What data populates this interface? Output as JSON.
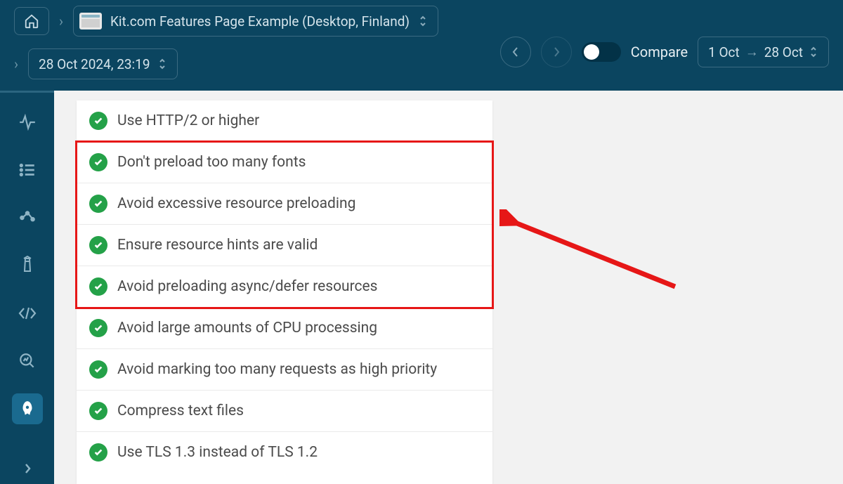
{
  "header": {
    "breadcrumb_title": "Kit.com Features Page Example (Desktop, Finland)",
    "datetime": "28 Oct 2024, 23:19",
    "compare_label": "Compare",
    "range_from": "1 Oct",
    "range_to": "28 Oct"
  },
  "sidebar": {
    "items": [
      {
        "name": "pulse-icon"
      },
      {
        "name": "list-icon"
      },
      {
        "name": "network-icon"
      },
      {
        "name": "lighthouse-icon"
      },
      {
        "name": "code-icon"
      },
      {
        "name": "search-chart-icon"
      },
      {
        "name": "rocket-icon",
        "active": true
      }
    ]
  },
  "audits": [
    {
      "label": "Use HTTP/2 or higher"
    },
    {
      "label": "Don't preload too many fonts"
    },
    {
      "label": "Avoid excessive resource preloading"
    },
    {
      "label": "Ensure resource hints are valid"
    },
    {
      "label": "Avoid preloading async/defer resources"
    },
    {
      "label": "Avoid large amounts of CPU processing"
    },
    {
      "label": "Avoid marking too many requests as high priority"
    },
    {
      "label": "Compress text files"
    },
    {
      "label": "Use TLS 1.3 instead of TLS 1.2"
    }
  ],
  "annotation": {
    "highlight_indices": [
      1,
      2,
      3,
      4
    ]
  }
}
